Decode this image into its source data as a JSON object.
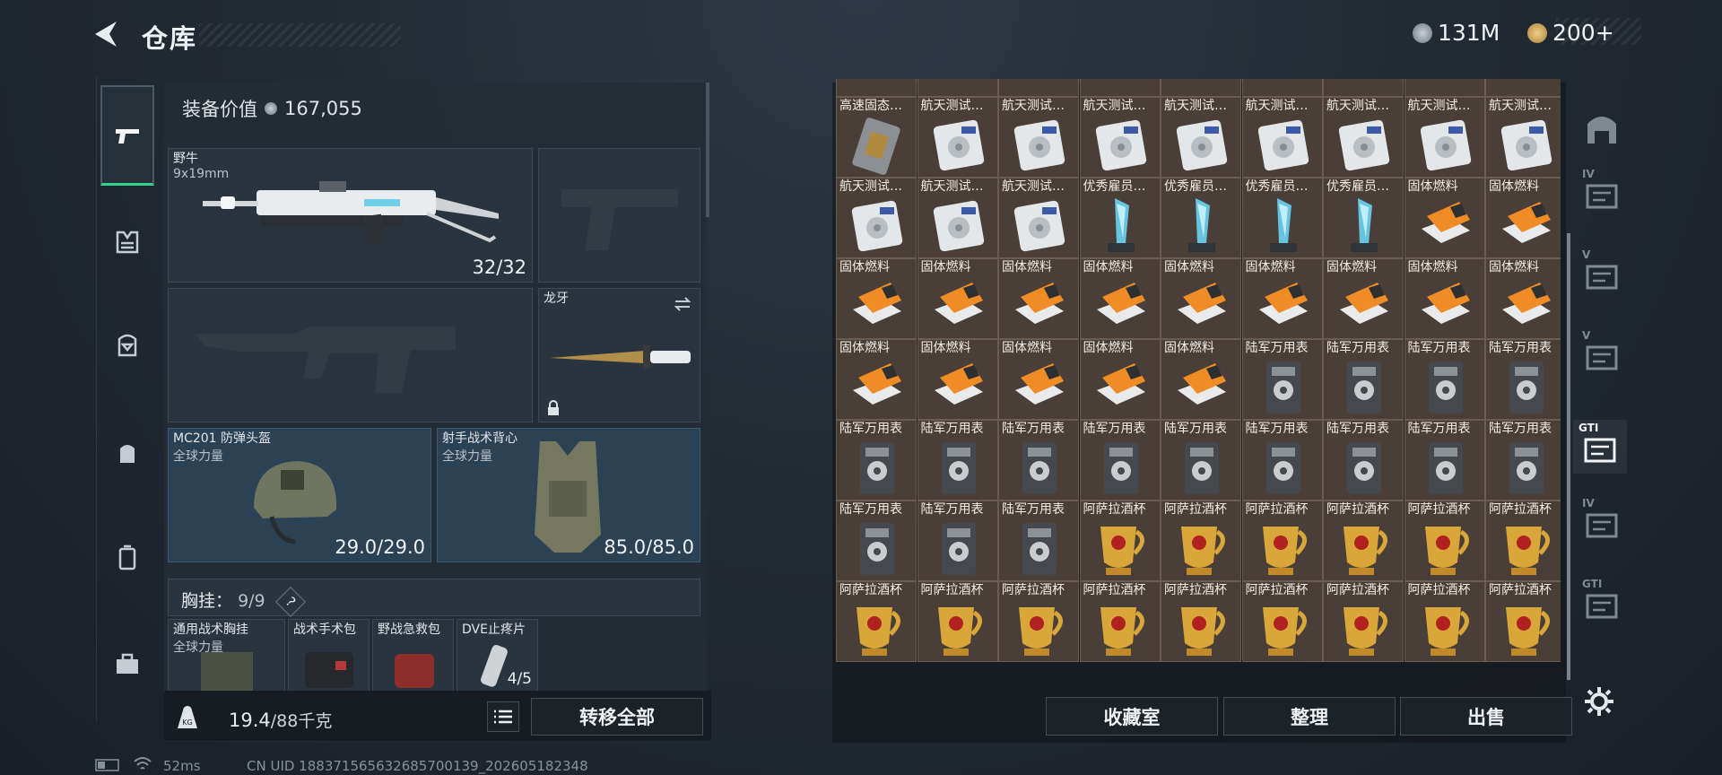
{
  "header": {
    "title": "仓库",
    "currency_a": "131M",
    "currency_b": "200+",
    "colors": {
      "accent": "#2fd38b",
      "coin_a": "#9aa3ab",
      "coin_b": "#caa25a"
    }
  },
  "left_tabs": [
    "pistol-icon",
    "armor-icon",
    "backpack-icon",
    "bag-icon",
    "case-icon",
    "toolbox-icon"
  ],
  "equipment": {
    "value_label": "装备价值",
    "value": "167,055",
    "primary_weapon": {
      "name": "野牛",
      "caliber": "9x19mm",
      "ammo": "32/32"
    },
    "melee": {
      "name": "龙牙"
    },
    "helmet": {
      "name": "MC201 防弹头盔",
      "faction": "全球力量",
      "durability": "29.0/29.0"
    },
    "vest": {
      "name": "射手战术背心",
      "faction": "全球力量",
      "durability": "85.0/85.0"
    },
    "chest_rig": {
      "label": "胸挂：",
      "capacity": "9/9",
      "help": "?"
    },
    "rig_items": [
      {
        "name": "通用战术胸挂",
        "sub": "全球力量",
        "count": ""
      },
      {
        "name": "战术手术包",
        "sub": "",
        "count": ""
      },
      {
        "name": "野战急救包",
        "sub": "",
        "count": ""
      },
      {
        "name": "DVE止疼片",
        "sub": "",
        "count": "4/5"
      }
    ]
  },
  "bottom": {
    "weight_value": "19.4",
    "weight_cap": "/88千克",
    "transfer_all": "转移全部"
  },
  "status": {
    "ping": "52ms",
    "uid": "CN UID 188371565632685700139_202605182348"
  },
  "inventory": {
    "rows": [
      [
        "",
        "",
        "",
        "",
        "",
        "",
        "",
        "",
        ""
      ],
      [
        "高速固态…",
        "航天测试…",
        "航天测试…",
        "航天测试…",
        "航天测试…",
        "航天测试…",
        "航天测试…",
        "航天测试…",
        "航天测试…"
      ],
      [
        "航天测试…",
        "航天测试…",
        "航天测试…",
        "优秀雇员…",
        "优秀雇员…",
        "优秀雇员…",
        "优秀雇员…",
        "固体燃料",
        "固体燃料"
      ],
      [
        "固体燃料",
        "固体燃料",
        "固体燃料",
        "固体燃料",
        "固体燃料",
        "固体燃料",
        "固体燃料",
        "固体燃料",
        "固体燃料"
      ],
      [
        "固体燃料",
        "固体燃料",
        "固体燃料",
        "固体燃料",
        "固体燃料",
        "陆军万用表",
        "陆军万用表",
        "陆军万用表",
        "陆军万用表"
      ],
      [
        "陆军万用表",
        "陆军万用表",
        "陆军万用表",
        "陆军万用表",
        "陆军万用表",
        "陆军万用表",
        "陆军万用表",
        "陆军万用表",
        "陆军万用表"
      ],
      [
        "陆军万用表",
        "陆军万用表",
        "陆军万用表",
        "阿萨拉酒杯",
        "阿萨拉酒杯",
        "阿萨拉酒杯",
        "阿萨拉酒杯",
        "阿萨拉酒杯",
        "阿萨拉酒杯"
      ],
      [
        "阿萨拉酒杯",
        "阿萨拉酒杯",
        "阿萨拉酒杯",
        "阿萨拉酒杯",
        "阿萨拉酒杯",
        "阿萨拉酒杯",
        "阿萨拉酒杯",
        "阿萨拉酒杯",
        "阿萨拉酒杯"
      ]
    ],
    "icons": [
      [
        "server-icon",
        "server-icon",
        "server-icon",
        "server-icon",
        "server-icon",
        "server-icon",
        "server-icon",
        "server-icon",
        "server-icon"
      ],
      [
        "ssd-icon",
        "disk-icon",
        "disk-icon",
        "disk-icon",
        "disk-icon",
        "disk-icon",
        "disk-icon",
        "disk-icon",
        "disk-icon"
      ],
      [
        "disk-icon",
        "disk-icon",
        "disk-icon",
        "trophy-icon",
        "trophy-icon",
        "trophy-icon",
        "trophy-icon",
        "fuel-icon",
        "fuel-icon"
      ],
      [
        "fuel-icon",
        "fuel-icon",
        "fuel-icon",
        "fuel-icon",
        "fuel-icon",
        "fuel-icon",
        "fuel-icon",
        "fuel-icon",
        "fuel-icon"
      ],
      [
        "fuel-icon",
        "fuel-icon",
        "fuel-icon",
        "fuel-icon",
        "fuel-icon",
        "multimeter-icon",
        "multimeter-icon",
        "multimeter-icon",
        "multimeter-icon"
      ],
      [
        "multimeter-icon",
        "multimeter-icon",
        "multimeter-icon",
        "multimeter-icon",
        "multimeter-icon",
        "multimeter-icon",
        "multimeter-icon",
        "multimeter-icon",
        "multimeter-icon"
      ],
      [
        "multimeter-icon",
        "multimeter-icon",
        "multimeter-icon",
        "cup-icon",
        "cup-icon",
        "cup-icon",
        "cup-icon",
        "cup-icon",
        "cup-icon"
      ],
      [
        "cup-icon",
        "cup-icon",
        "cup-icon",
        "cup-icon",
        "cup-icon",
        "cup-icon",
        "cup-icon",
        "cup-icon",
        "cup-icon"
      ]
    ],
    "actions": {
      "collection": "收藏室",
      "sort": "整理",
      "sell": "出售"
    }
  },
  "right_tabs": [
    {
      "icon": "vault-icon",
      "label": ""
    },
    {
      "icon": "tier-iv-box-icon",
      "label": "IV"
    },
    {
      "icon": "tier-v-case-icon",
      "label": "V"
    },
    {
      "icon": "tier-v-case-search-icon",
      "label": "V"
    },
    {
      "icon": "gti-case-icon",
      "label": "GTI"
    },
    {
      "icon": "tier-iv-add-icon",
      "label": "IV"
    },
    {
      "icon": "gti-case-icon",
      "label": "GTI"
    }
  ]
}
